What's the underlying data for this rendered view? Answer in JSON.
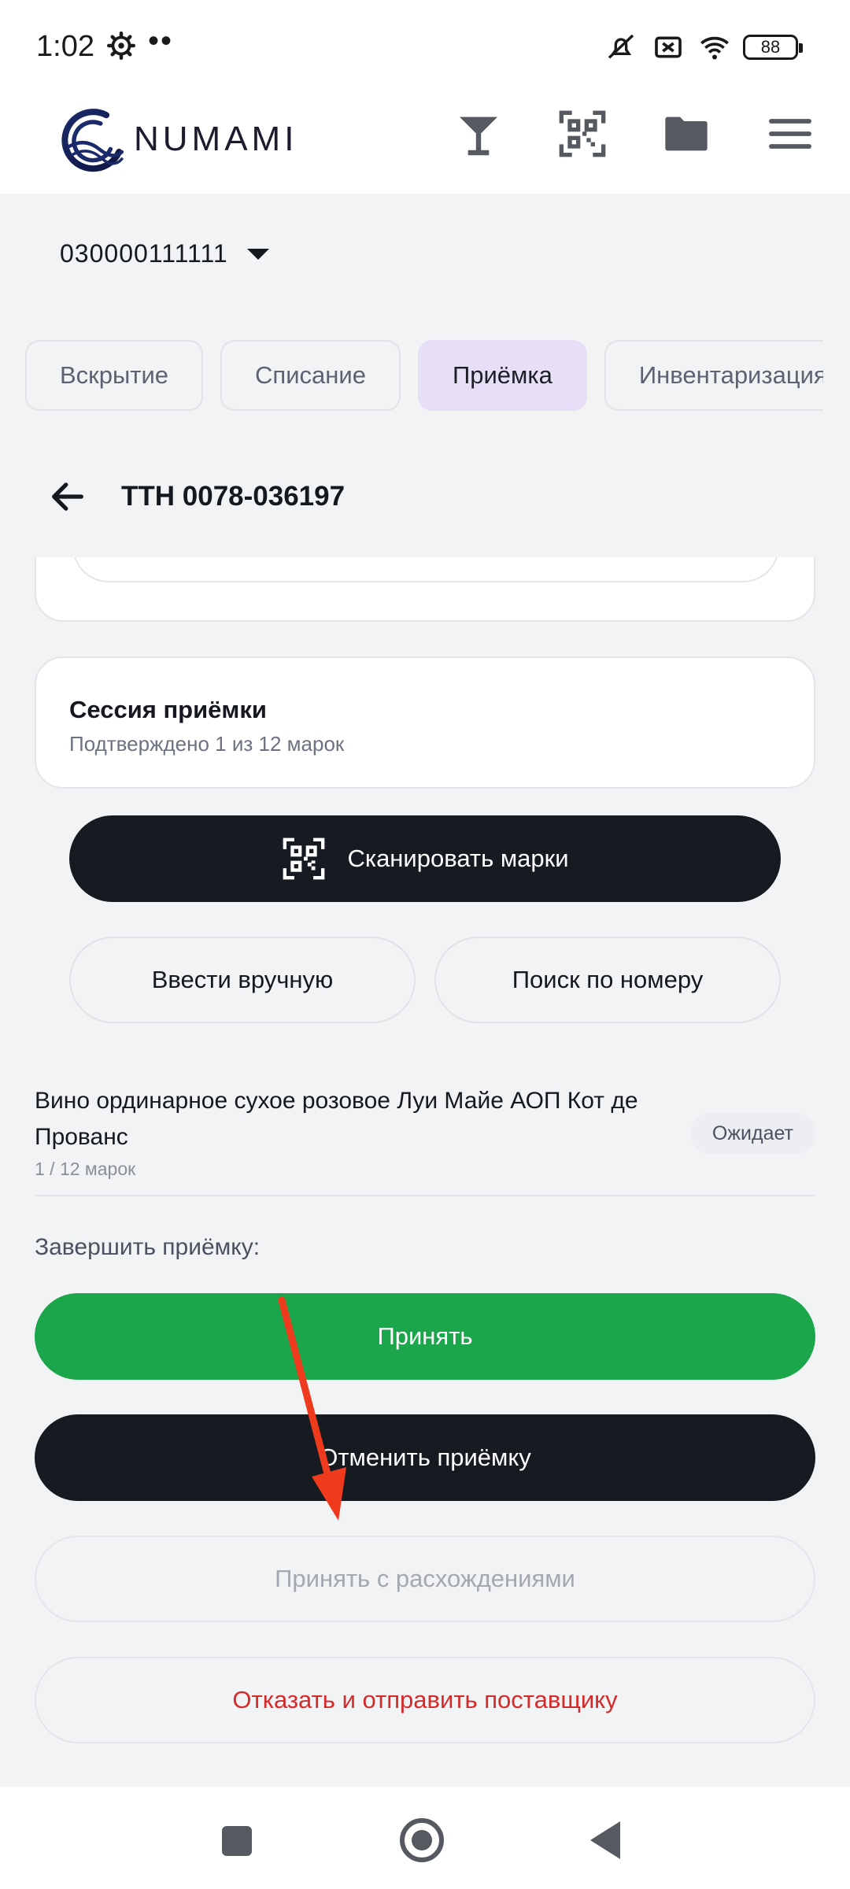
{
  "status_bar": {
    "time": "1:02",
    "battery": "88",
    "icons": [
      "gear-icon",
      "mute-icon",
      "sim-off-icon",
      "wifi-icon",
      "battery-icon"
    ]
  },
  "header": {
    "brand": "NUMAMI",
    "icons": [
      "cocktail-glass-icon",
      "qr-scan-icon",
      "folder-icon",
      "menu-icon"
    ]
  },
  "org_selector": {
    "value": "030000111111"
  },
  "tabs": [
    {
      "label": "Вскрытие",
      "active": false
    },
    {
      "label": "Списание",
      "active": false
    },
    {
      "label": "Приёмка",
      "active": true
    },
    {
      "label": "Инвентаризация",
      "active": false
    }
  ],
  "document": {
    "title": "ТТН 0078-036197"
  },
  "session": {
    "title": "Сессия приёмки",
    "subtitle": "Подтверждено 1 из 12 марок"
  },
  "actions": {
    "scan_label": "Сканировать марки",
    "manual_label": "Ввести вручную",
    "search_label": "Поиск по номеру"
  },
  "item": {
    "name": "Вино ординарное сухое розовое Луи Майе АОП Кот де Прованс",
    "count": "1 / 12 марок",
    "status": "Ожидает"
  },
  "finish": {
    "label": "Завершить приёмку:",
    "accept": "Принять",
    "cancel": "Отменить приёмку",
    "accept_discrepancy": "Принять с расхождениями",
    "reject": "Отказать и отправить поставщику"
  },
  "colors": {
    "accent_green": "#1ca64c",
    "dark": "#161a21",
    "reject_red": "#d42a2a",
    "active_tab": "#e7def7",
    "annotation_arrow": "#f03a1e"
  }
}
